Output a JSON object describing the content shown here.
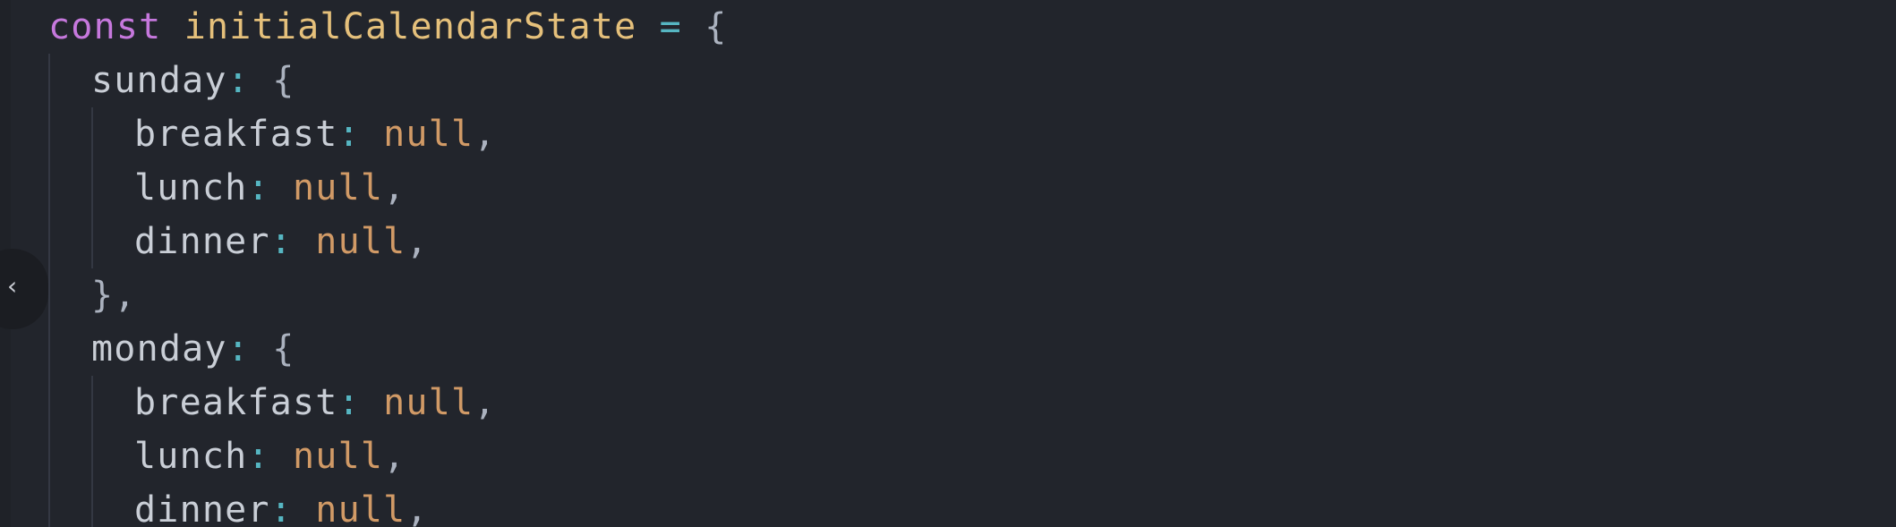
{
  "editor": {
    "collapse_glyph": "‹",
    "lines": [
      {
        "indent": 0,
        "tokens": [
          {
            "kind": "kw",
            "text": "const"
          },
          {
            "kind": "plain",
            "text": " "
          },
          {
            "kind": "def",
            "text": "initialCalendarState"
          },
          {
            "kind": "plain",
            "text": " "
          },
          {
            "kind": "op",
            "text": "="
          },
          {
            "kind": "plain",
            "text": " "
          },
          {
            "kind": "punc",
            "text": "{"
          }
        ]
      },
      {
        "indent": 1,
        "tokens": [
          {
            "kind": "prop",
            "text": "sunday"
          },
          {
            "kind": "op",
            "text": ":"
          },
          {
            "kind": "plain",
            "text": " "
          },
          {
            "kind": "punc",
            "text": "{"
          }
        ]
      },
      {
        "indent": 2,
        "tokens": [
          {
            "kind": "prop",
            "text": "breakfast"
          },
          {
            "kind": "op",
            "text": ":"
          },
          {
            "kind": "plain",
            "text": " "
          },
          {
            "kind": "null",
            "text": "null"
          },
          {
            "kind": "punc",
            "text": ","
          }
        ]
      },
      {
        "indent": 2,
        "tokens": [
          {
            "kind": "prop",
            "text": "lunch"
          },
          {
            "kind": "op",
            "text": ":"
          },
          {
            "kind": "plain",
            "text": " "
          },
          {
            "kind": "null",
            "text": "null"
          },
          {
            "kind": "punc",
            "text": ","
          }
        ]
      },
      {
        "indent": 2,
        "tokens": [
          {
            "kind": "prop",
            "text": "dinner"
          },
          {
            "kind": "op",
            "text": ":"
          },
          {
            "kind": "plain",
            "text": " "
          },
          {
            "kind": "null",
            "text": "null"
          },
          {
            "kind": "punc",
            "text": ","
          }
        ]
      },
      {
        "indent": 1,
        "tokens": [
          {
            "kind": "punc",
            "text": "},"
          }
        ]
      },
      {
        "indent": 1,
        "tokens": [
          {
            "kind": "prop",
            "text": "monday"
          },
          {
            "kind": "op",
            "text": ":"
          },
          {
            "kind": "plain",
            "text": " "
          },
          {
            "kind": "punc",
            "text": "{"
          }
        ]
      },
      {
        "indent": 2,
        "tokens": [
          {
            "kind": "prop",
            "text": "breakfast"
          },
          {
            "kind": "op",
            "text": ":"
          },
          {
            "kind": "plain",
            "text": " "
          },
          {
            "kind": "null",
            "text": "null"
          },
          {
            "kind": "punc",
            "text": ","
          }
        ]
      },
      {
        "indent": 2,
        "tokens": [
          {
            "kind": "prop",
            "text": "lunch"
          },
          {
            "kind": "op",
            "text": ":"
          },
          {
            "kind": "plain",
            "text": " "
          },
          {
            "kind": "null",
            "text": "null"
          },
          {
            "kind": "punc",
            "text": ","
          }
        ]
      },
      {
        "indent": 2,
        "tokens": [
          {
            "kind": "prop",
            "text": "dinner"
          },
          {
            "kind": "op",
            "text": ":"
          },
          {
            "kind": "plain",
            "text": " "
          },
          {
            "kind": "null",
            "text": "null"
          },
          {
            "kind": "punc",
            "text": ","
          }
        ]
      }
    ]
  },
  "colors": {
    "background": "#22252c",
    "keyword": "#c678dd",
    "definition": "#e5c07b",
    "operator": "#56b6c2",
    "property": "#c9ced6",
    "null_literal": "#d19a66",
    "punctuation": "#abb2bf"
  }
}
